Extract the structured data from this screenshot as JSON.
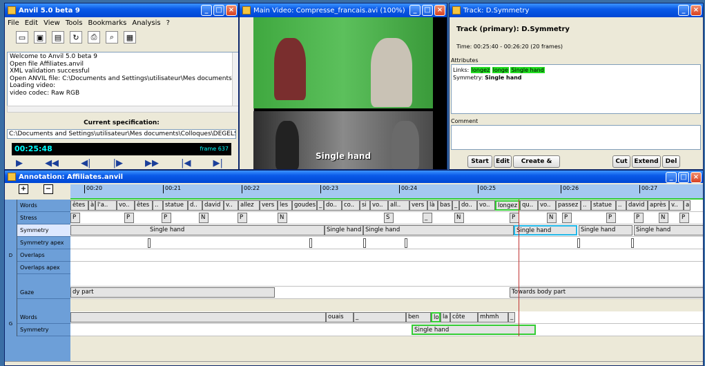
{
  "anvil": {
    "title": "Anvil 5.0 beta 9",
    "menu": [
      "File",
      "Edit",
      "View",
      "Tools",
      "Bookmarks",
      "Analysis",
      "?"
    ],
    "log": [
      "Welcome to Anvil 5.0 beta 9",
      "Open file Affiliates.anvil",
      "XML validation successful",
      "Open ANVIL file: C:\\Documents and Settings\\utilisateur\\Mes documents\\Col",
      "Loading video:",
      "    video codec: Raw RGB"
    ],
    "spec_title": "Current specification:",
    "spec_path": "C:\\Documents and Settings\\utilisateur\\Mes documents\\Colloques\\DEGELS",
    "time": "00:25:48",
    "frame": "frame 637"
  },
  "video": {
    "title": "Main Video: Compresse_francais.avi (100%)",
    "overlay": "Single hand"
  },
  "track": {
    "title": "Track: D.Symmetry",
    "heading": "Track (primary): D.Symmetry",
    "time": "Time: 00:25:40 - 00:26:20 (20 frames)",
    "attributes_label": "Attributes",
    "links_label": "Links:",
    "links": [
      "longez",
      "longe",
      "Single hand"
    ],
    "symmetry_label": "Symmetry:",
    "symmetry_value": "Single hand",
    "comment_label": "Comment",
    "buttons": {
      "start": "Start",
      "edit": "Edit",
      "create_edit": "Create & Edit",
      "cut": "Cut",
      "extend": "Extend",
      "del": "Del"
    }
  },
  "annotation": {
    "title": "Annotation: Affiliates.anvil",
    "zoom_in": "+",
    "zoom_out": "−",
    "ticks": [
      "00:20",
      "00:21",
      "00:22",
      "00:23",
      "00:24",
      "00:25",
      "00:26",
      "00:27"
    ],
    "groups": {
      "d": "D",
      "g": "G"
    },
    "tracks": [
      "Words",
      "Stress",
      "Symmetry",
      "Symmetry apex",
      "Overlaps",
      "Overlaps apex",
      "Gaze",
      "Words",
      "Symmetry"
    ],
    "elements": {
      "words_d": [
        "êtes",
        "à",
        "l'a..",
        "vo..",
        "êtes",
        "..",
        "statue",
        "d..",
        "david",
        "v..",
        "allez",
        "vers",
        "les",
        "goudes",
        "_",
        "do..",
        "co..",
        "si",
        "vo..",
        "all..",
        "vers",
        "là",
        "bas",
        "_",
        "do..",
        "vo..",
        "longez",
        "qu..",
        "vo..",
        "passez",
        "..",
        "statue",
        "..",
        "david",
        "après",
        "v..",
        "a"
      ],
      "stress": [
        "P",
        "P",
        "P",
        "N",
        "P",
        "N",
        "S",
        "_",
        "N",
        "P",
        "N",
        "P",
        "P",
        "P",
        "N",
        "P"
      ],
      "symmetry_d": [
        "Single hand",
        "Single hand",
        "Single hand",
        "Single hand",
        "Single hand",
        "Single hand"
      ],
      "gaze": [
        "dy part",
        "Towards body part"
      ],
      "words_g": [
        "ouais",
        "_",
        "ben",
        "lo..",
        "la",
        "côte",
        "mhmh",
        "_"
      ],
      "symmetry_g": [
        "Single hand"
      ]
    }
  }
}
